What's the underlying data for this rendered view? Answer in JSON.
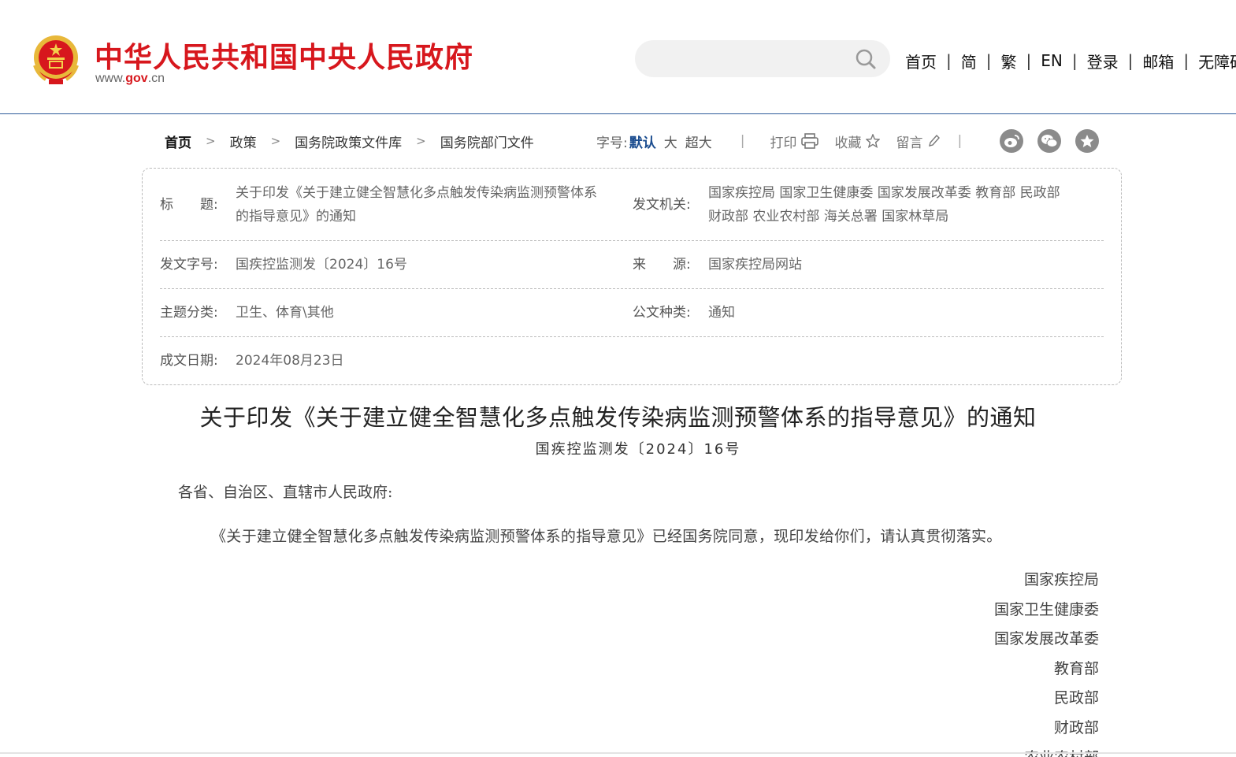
{
  "header": {
    "site_title": "中华人民共和国中央人民政府",
    "site_url_prefix": "www.",
    "site_url_brand": "gov",
    "site_url_suffix": ".cn",
    "search_placeholder": "",
    "search_value": "",
    "nav": [
      "首页",
      "简",
      "繁",
      "EN",
      "登录",
      "邮箱",
      "无障碍"
    ],
    "brand_color": "#d7171d"
  },
  "breadcrumb": [
    "首页",
    "政策",
    "国务院政策文件库",
    "国务院部门文件"
  ],
  "tools": {
    "font_label": "字号:",
    "font_default": "默认",
    "font_large": "大",
    "font_xlarge": "超大",
    "print": "打印",
    "favorite": "收藏",
    "comment": "留言",
    "share_icons": [
      "weibo-icon",
      "wechat-icon",
      "star-share-icon"
    ],
    "accent_color": "#1a4c8f"
  },
  "meta": {
    "title_label": "标　　题:",
    "title_value_line1": "关于印发《关于建立健全智慧化多点触发传染病监测预警体系",
    "title_value_line2": "的指导意见》的通知",
    "issuer_label": "发文机关:",
    "issuer_line1": "国家疾控局 国家卫生健康委 国家发展改革委 教育部 民政部",
    "issuer_line2": "财政部 农业农村部 海关总署 国家林草局",
    "doc_no_label": "发文字号:",
    "doc_no_value": "国疾控监测发〔2024〕16号",
    "source_label": "来　　源:",
    "source_value": "国家疾控局网站",
    "topic_label": "主题分类:",
    "topic_value": "卫生、体育\\其他",
    "type_label": "公文种类:",
    "type_value": "通知",
    "date_label": "成文日期:",
    "date_value": "2024年08月23日"
  },
  "document": {
    "title": "关于印发《关于建立健全智慧化多点触发传染病监测预警体系的指导意见》的通知",
    "number": "国疾控监测发〔2024〕16号",
    "salutation": "各省、自治区、直辖市人民政府:",
    "paragraph": "《关于建立健全智慧化多点触发传染病监测预警体系的指导意见》已经国务院同意，现印发给你们，请认真贯彻落实。",
    "signers": [
      "国家疾控局",
      "国家卫生健康委",
      "国家发展改革委",
      "教育部",
      "民政部",
      "财政部",
      "农业农村部"
    ]
  }
}
